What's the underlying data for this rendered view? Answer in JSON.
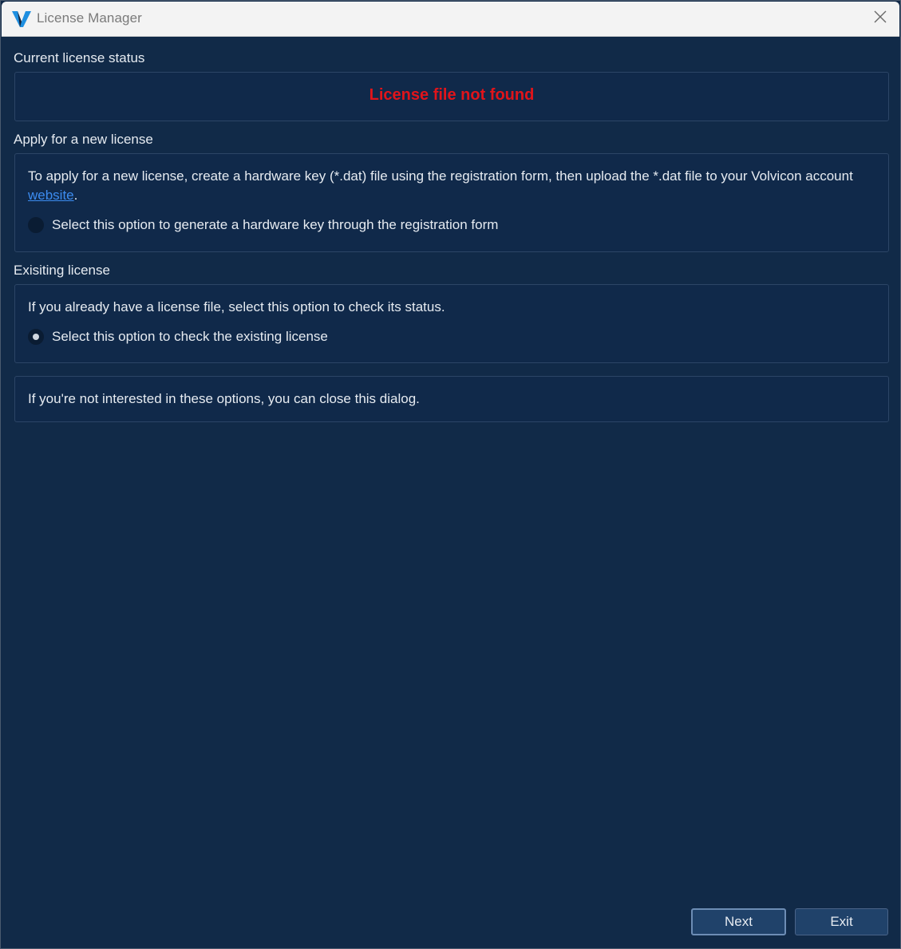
{
  "window": {
    "title": "License Manager"
  },
  "status": {
    "section_label": "Current license status",
    "message": "License file not found",
    "message_color": "#e1141a"
  },
  "new_license": {
    "section_label": "Apply for a new license",
    "description_part1": "To apply for a new license, create a hardware key (*.dat) file using the registration form, then upload the *.dat file to your Volvicon account ",
    "link_text": "website",
    "description_part2": ".",
    "option_label": "Select this option to generate a hardware key through the registration form",
    "option_selected": false
  },
  "existing_license": {
    "section_label": "Exisiting license",
    "description": "If you already have a license file, select this option to check its status.",
    "option_label": "Select this option to check the existing license",
    "option_selected": true
  },
  "close_note": {
    "text": "If you're not interested in these options, you can close this dialog."
  },
  "buttons": {
    "next_label": "Next",
    "exit_label": "Exit"
  },
  "colors": {
    "background": "#112a48",
    "link": "#3c8cf0",
    "logo": "#1f8fe0"
  },
  "icons": {
    "app_logo": "volvicon-logo-icon",
    "close": "close-icon"
  }
}
